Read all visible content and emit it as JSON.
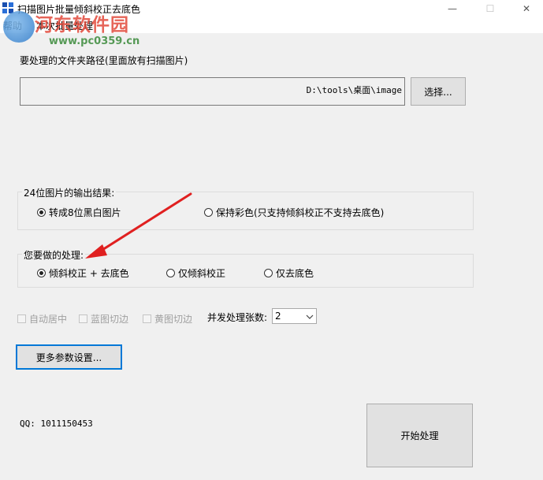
{
  "window": {
    "title": "扫描图片批量倾斜校正去底色",
    "minimize_glyph": "—",
    "maximize_glyph": "☐",
    "close_glyph": "✕"
  },
  "menu": {
    "items": [
      "帮助",
      "本次批量处理"
    ]
  },
  "watermark": {
    "title": "河东软件园",
    "url": "www.pc0359.cn"
  },
  "folder": {
    "label": "要处理的文件夹路径(里面放有扫描图片)",
    "path": "D:\\tools\\桌面\\image",
    "select_button": "选择..."
  },
  "output_group": {
    "title": "24位图片的输出结果:",
    "options": [
      {
        "label": "转成8位黑白图片",
        "selected": true
      },
      {
        "label": "保持彩色(只支持倾斜校正不支持去底色)",
        "selected": false
      }
    ]
  },
  "process_group": {
    "title": "您要做的处理:",
    "options": [
      {
        "label": "倾斜校正 + 去底色",
        "selected": true
      },
      {
        "label": "仅倾斜校正",
        "selected": false
      },
      {
        "label": "仅去底色",
        "selected": false
      }
    ]
  },
  "options_row": {
    "checkboxes": [
      {
        "label": "自动居中",
        "checked": false,
        "enabled": false
      },
      {
        "label": "蓝图切边",
        "checked": false,
        "enabled": false
      },
      {
        "label": "黄图切边",
        "checked": false,
        "enabled": false
      }
    ],
    "concurrency_label": "并发处理张数:",
    "concurrency_value": "2"
  },
  "more_button": "更多参数设置...",
  "qq": "QQ: 1011150453",
  "start_button": "开始处理",
  "colors": {
    "accent": "#0078d7",
    "arrow": "#e02020",
    "background": "#f0f0f0"
  }
}
